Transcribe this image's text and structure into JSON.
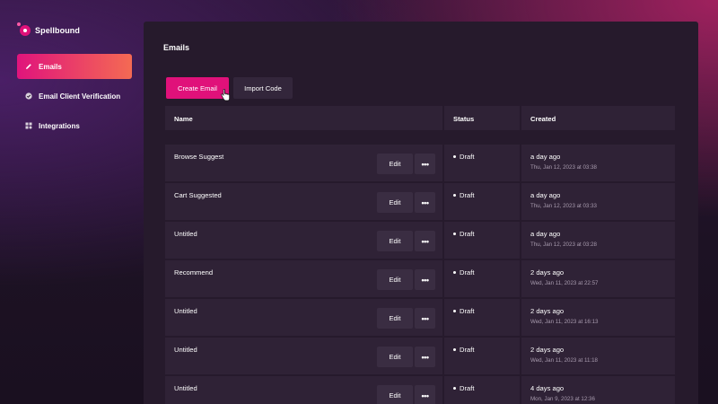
{
  "brand": {
    "name": "Spellbound",
    "accent": "#e0117a"
  },
  "sidebar": {
    "items": [
      {
        "label": "Emails",
        "icon": "pencil-icon",
        "active": true
      },
      {
        "label": "Email Client Verification",
        "icon": "check-circle-icon",
        "active": false
      },
      {
        "label": "Integrations",
        "icon": "grid-icon",
        "active": false
      }
    ]
  },
  "main": {
    "title": "Emails",
    "actions": {
      "create_label": "Create Email",
      "import_label": "Import Code"
    },
    "table": {
      "headers": {
        "name": "Name",
        "status": "Status",
        "created": "Created"
      },
      "edit_label": "Edit",
      "more_label": "•••",
      "rows": [
        {
          "name": "Browse Suggest",
          "status": "Draft",
          "created": "a day ago",
          "created_full": "Thu, Jan 12, 2023 at 03:38"
        },
        {
          "name": "Cart Suggested",
          "status": "Draft",
          "created": "a day ago",
          "created_full": "Thu, Jan 12, 2023 at 03:33"
        },
        {
          "name": "Untitled",
          "status": "Draft",
          "created": "a day ago",
          "created_full": "Thu, Jan 12, 2023 at 03:28"
        },
        {
          "name": "Recommend",
          "status": "Draft",
          "created": "2 days ago",
          "created_full": "Wed, Jan 11, 2023 at 22:57"
        },
        {
          "name": "Untitled",
          "status": "Draft",
          "created": "2 days ago",
          "created_full": "Wed, Jan 11, 2023 at 16:13"
        },
        {
          "name": "Untitled",
          "status": "Draft",
          "created": "2 days ago",
          "created_full": "Wed, Jan 11, 2023 at 11:18"
        },
        {
          "name": "Untitled",
          "status": "Draft",
          "created": "4 days ago",
          "created_full": "Mon, Jan 9, 2023 at 12:36"
        }
      ]
    }
  }
}
